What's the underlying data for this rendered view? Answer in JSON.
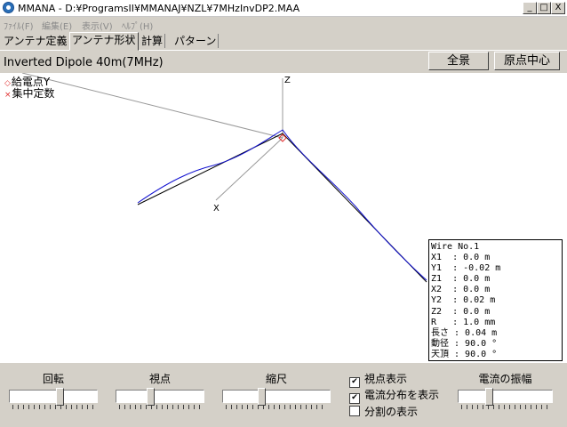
{
  "window": {
    "title": "MMANA - D:¥ProgramsII¥MMANAJ¥NZL¥7MHzInvDP2.MAA",
    "minimize": "_",
    "maximize": "□",
    "close": "X"
  },
  "menu": [
    "ﾌｧｲﾙ(F)",
    "編集(E)",
    "表示(V)",
    "ﾍﾙﾌﾟ(H)"
  ],
  "tabs": [
    "アンテナ定義",
    "アンテナ形状",
    "計算",
    "パターン"
  ],
  "active_tab": "アンテナ形状",
  "antenna_title": "Inverted Dipole 40m(7MHz)",
  "buttons": {
    "overview": "全景",
    "origin_center": "原点中心"
  },
  "legend": {
    "feed_point": {
      "marker": "◇",
      "label": "給電点Y"
    },
    "lumped_constant": {
      "marker": "×",
      "label": "集中定数"
    }
  },
  "axes": {
    "z": "Z",
    "x": "X"
  },
  "wire_info": {
    "header": "Wire No.1",
    "lines": [
      "X1  : 0.0 m",
      "Y1  : -0.02 m",
      "Z1  : 0.0 m",
      "X2  : 0.0 m",
      "Y2  : 0.02 m",
      "Z2  : 0.0 m",
      "R   : 1.0 mm",
      "長さ : 0.04 m",
      "動径 : 90.0 °",
      "天頂 : 90.0 °"
    ]
  },
  "controls": {
    "rotation": {
      "label": "回転",
      "level": 0.58
    },
    "viewpoint": {
      "label": "視点",
      "level": 0.38
    },
    "scale": {
      "label": "縮尺",
      "level": 0.35
    },
    "current_amplitude": {
      "label": "電流の振幅",
      "level": 0.32
    }
  },
  "checkboxes": [
    {
      "label": "視点表示",
      "checked": true
    },
    {
      "label": "電流分布を表示",
      "checked": true
    },
    {
      "label": "分割の表示",
      "checked": false
    }
  ],
  "colors": {
    "current_trace": "#1010d0",
    "wire": "#000000",
    "feed_marker": "#e03030",
    "axis": "#999999"
  }
}
